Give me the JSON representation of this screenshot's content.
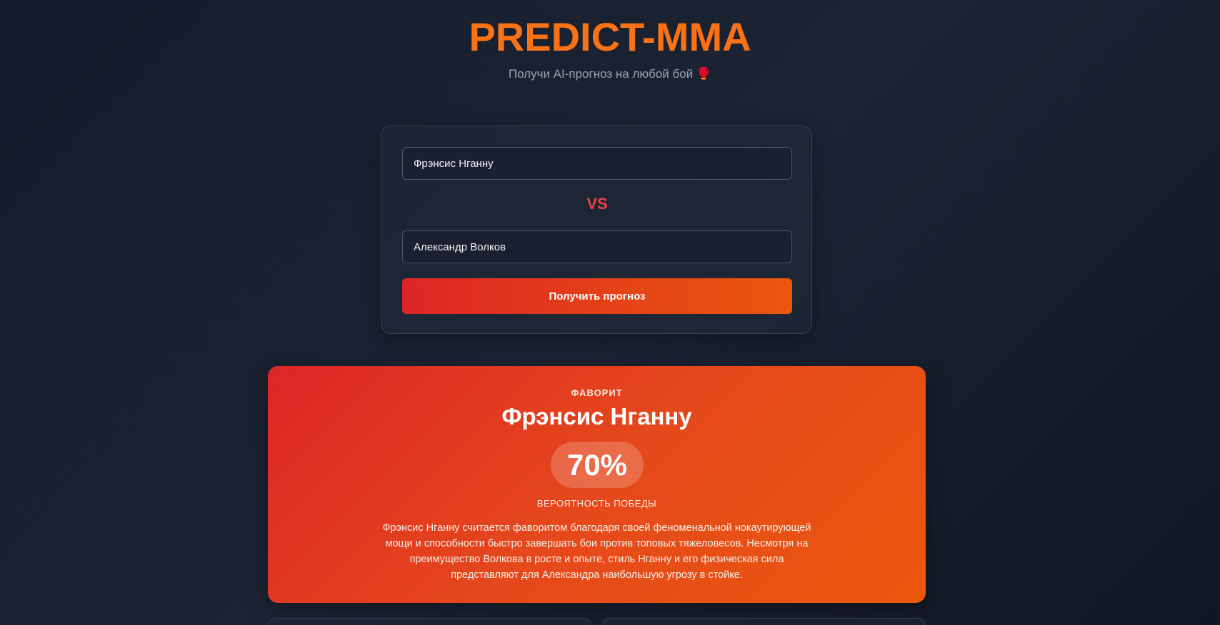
{
  "header": {
    "title": "PREDICT-MMA",
    "subtitle": "Получи AI-прогноз на любой бой 🥊"
  },
  "form": {
    "fighter1_value": "Фрэнсис Нганну",
    "vs_label": "VS",
    "fighter2_value": "Александр Волков",
    "submit_label": "Получить прогноз"
  },
  "result": {
    "favorite_label": "ФАВОРИТ",
    "winner_name": "Фрэнсис Нганну",
    "win_probability": "70%",
    "probability_label": "ВЕРОЯТНОСТЬ ПОБЕДЫ",
    "explanation": "Фрэнсис Нганну считается фаворитом благодаря своей феноменальной нокаутирующей мощи и способности быстро завершать бои против топовых тяжеловесов. Несмотря на преимущество Волкова в росте и опыте, стиль Нганну и его физическая сила представляют для Александра наибольшую угрозу в стойке."
  },
  "colors": {
    "brand_orange": "#f97316",
    "vs_red": "#ef4444",
    "button_gradient_start": "#dc2626",
    "button_gradient_end": "#ea580c"
  }
}
